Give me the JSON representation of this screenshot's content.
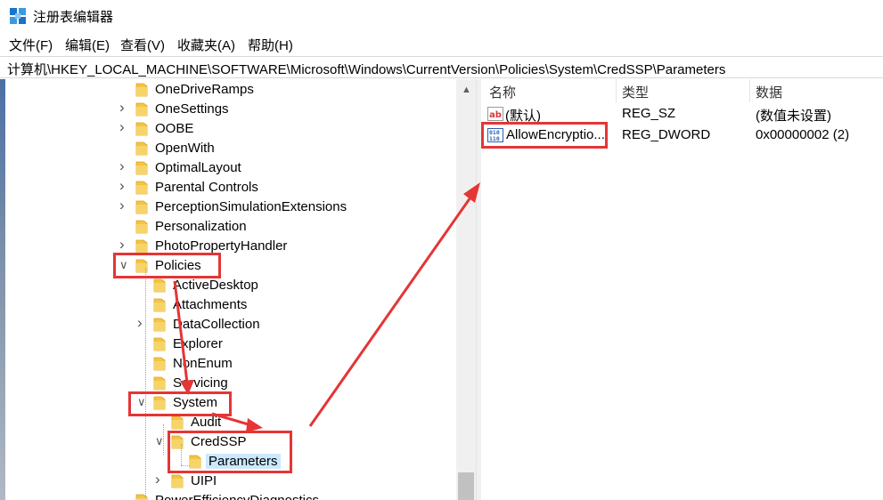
{
  "window": {
    "title": "注册表编辑器"
  },
  "menu": [
    "文件(F)",
    "编辑(E)",
    "查看(V)",
    "收藏夹(A)",
    "帮助(H)"
  ],
  "address": "计算机\\HKEY_LOCAL_MACHINE\\SOFTWARE\\Microsoft\\Windows\\CurrentVersion\\Policies\\System\\CredSSP\\Parameters",
  "tree": {
    "items": [
      {
        "label": "OneDriveRamps"
      },
      {
        "label": "OneSettings"
      },
      {
        "label": "OOBE"
      },
      {
        "label": "OpenWith"
      },
      {
        "label": "OptimalLayout"
      },
      {
        "label": "Parental Controls"
      },
      {
        "label": "PerceptionSimulationExtensions"
      },
      {
        "label": "Personalization"
      },
      {
        "label": "PhotoPropertyHandler"
      },
      {
        "label": "Policies"
      },
      {
        "label": "ActiveDesktop"
      },
      {
        "label": "Attachments"
      },
      {
        "label": "DataCollection"
      },
      {
        "label": "Explorer"
      },
      {
        "label": "NonEnum"
      },
      {
        "label": "Servicing"
      },
      {
        "label": "System"
      },
      {
        "label": "Audit"
      },
      {
        "label": "CredSSP"
      },
      {
        "label": "Parameters"
      },
      {
        "label": "UIPI"
      },
      {
        "label": "PowerEfficiencyDiagnostics"
      }
    ]
  },
  "list": {
    "columns": [
      "名称",
      "类型",
      "数据"
    ],
    "rows": [
      {
        "name": "(默认)",
        "type": "REG_SZ",
        "data": "(数值未设置)",
        "icon": "string-value-icon"
      },
      {
        "name": "AllowEncryptio...",
        "type": "REG_DWORD",
        "data": "0x00000002 (2)",
        "icon": "binary-value-icon"
      }
    ]
  },
  "colors": {
    "highlight": "#e53535",
    "selection": "#cce8ff",
    "folder": "#f4c542"
  }
}
